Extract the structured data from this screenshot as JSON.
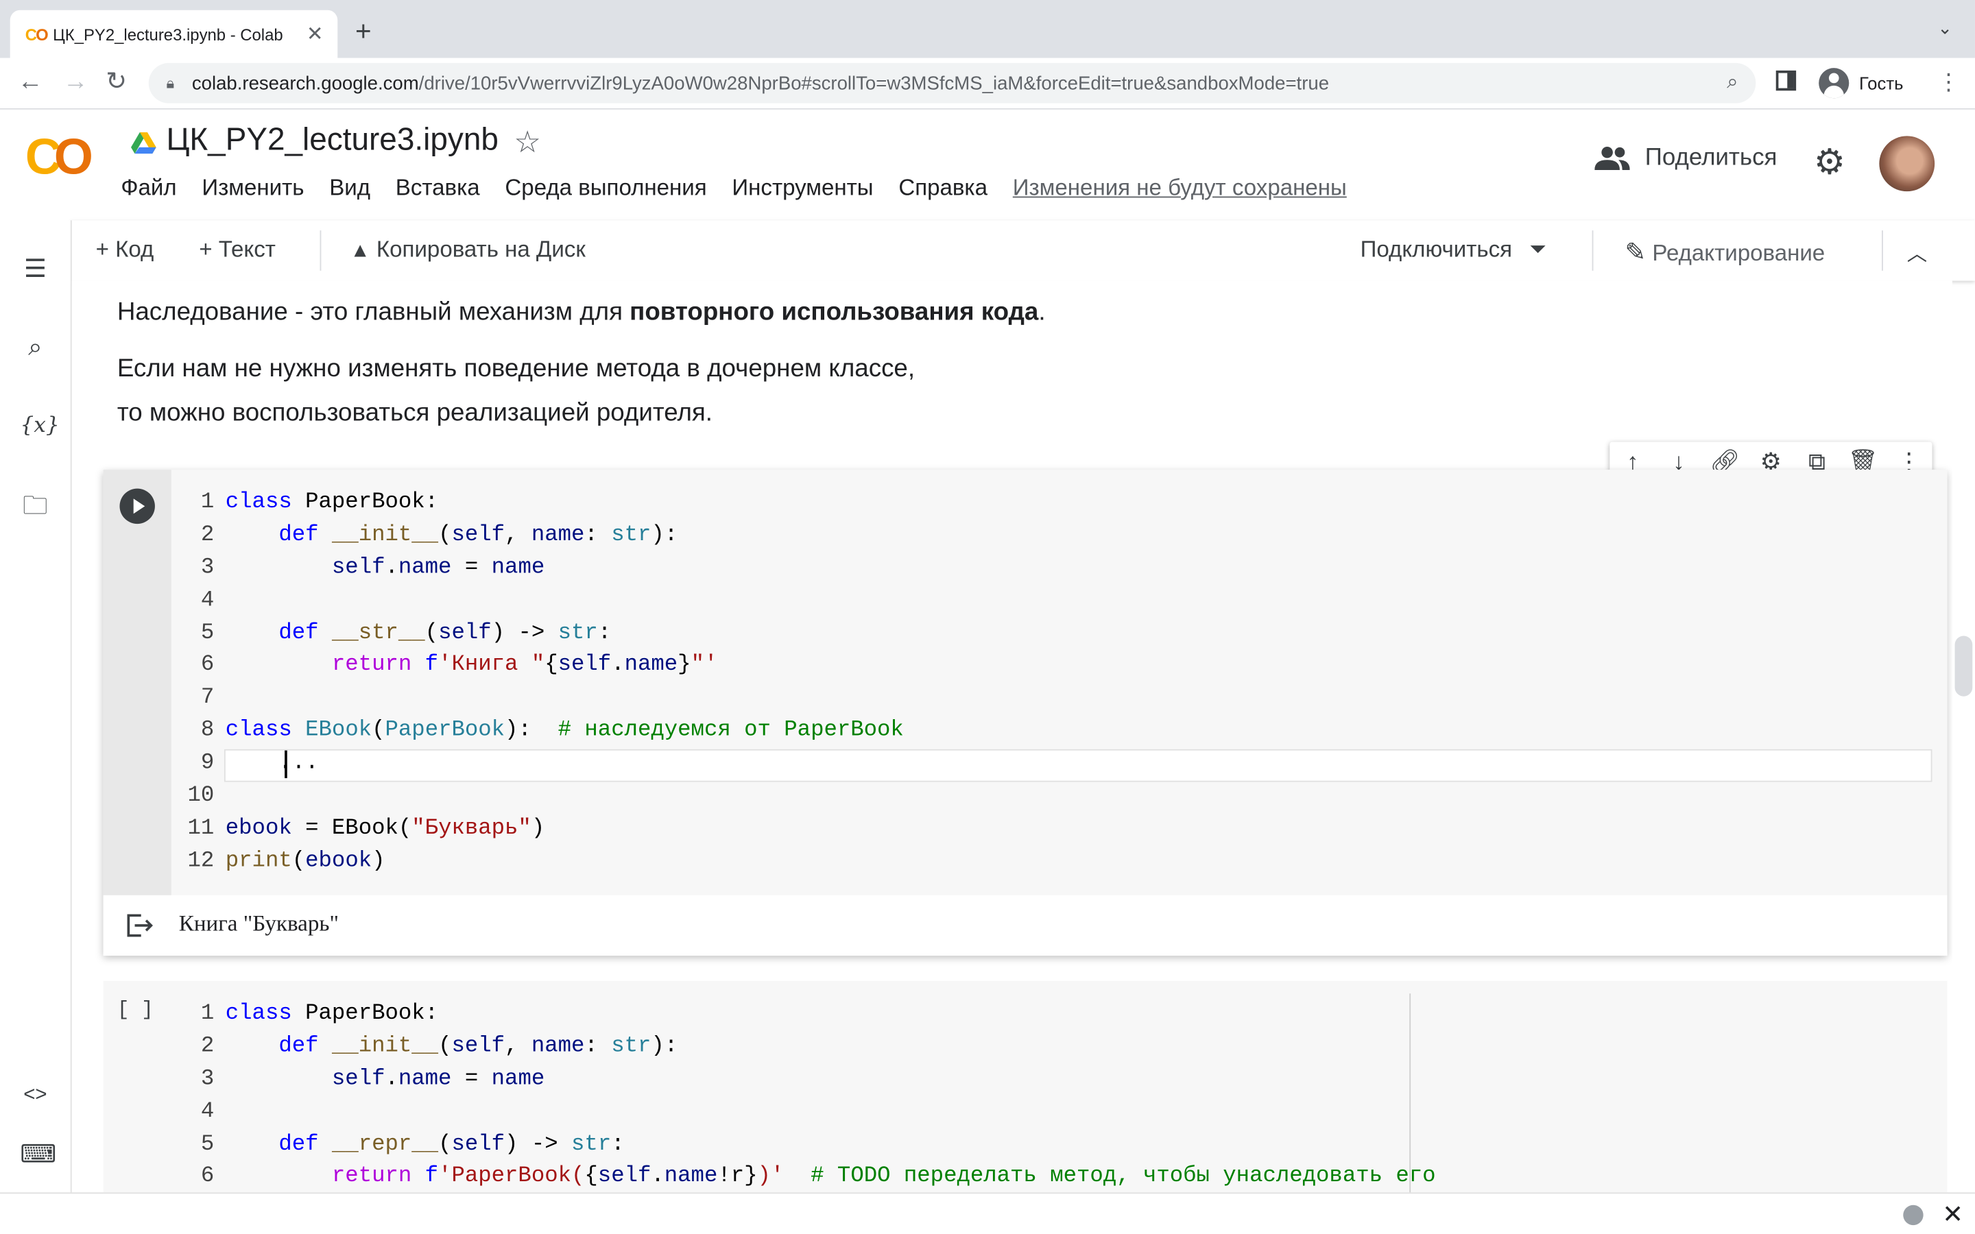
{
  "browser": {
    "tab_title": "ЦК_PY2_lecture3.ipynb - Colab",
    "url_domain": "colab.research.google.com",
    "url_path": "/drive/10r5vVwerrvviZlr9LyzA0oW0w28NprBo#scrollTo=w3MSfcMS_iaM&forceEdit=true&sandboxMode=true",
    "profile_label": "Гость"
  },
  "colab": {
    "notebook_title": "ЦК_PY2_lecture3.ipynb",
    "menu": [
      "Файл",
      "Изменить",
      "Вид",
      "Вставка",
      "Среда выполнения",
      "Инструменты",
      "Справка"
    ],
    "unsaved_notice": "Изменения не будут сохранены",
    "share_label": "Поделиться"
  },
  "commands": {
    "add_code": "+ Код",
    "add_text": "+ Текст",
    "copy_to_drive": "Копировать на Диск",
    "connect": "Подключиться",
    "editing": "Редактирование"
  },
  "text_cell": {
    "line1_pre": "Наследование - это главный механизм для ",
    "line1_bold": "повторного использования кода",
    "line1_post": ".",
    "line2": "Если нам не нужно изменять поведение метода в дочернем классе,",
    "line3": "то можно воспользоваться реализацией родителя."
  },
  "cell1": {
    "line_numbers": [
      "1",
      "2",
      "3",
      "4",
      "5",
      "6",
      "7",
      "8",
      "9",
      "10",
      "11",
      "12"
    ],
    "output_text": "Книга \"Букварь\""
  },
  "cell2": {
    "bracket": "[ ]",
    "line_numbers": [
      "1",
      "2",
      "3",
      "4",
      "5",
      "6"
    ]
  }
}
